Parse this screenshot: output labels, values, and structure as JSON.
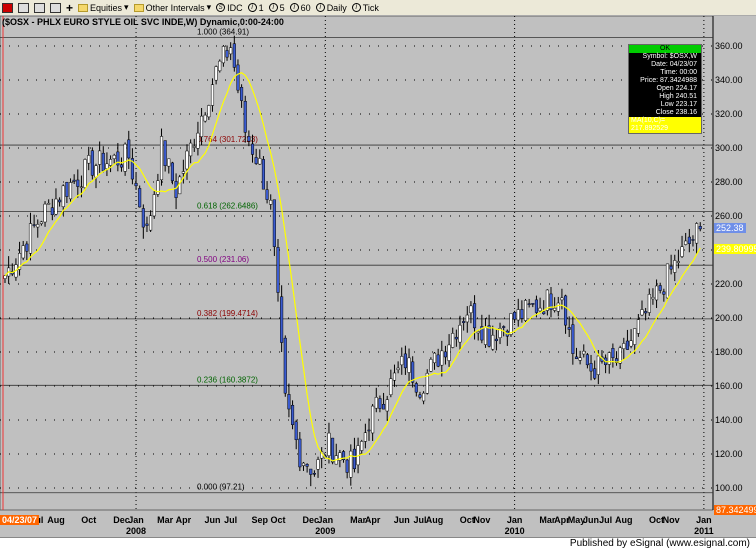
{
  "toolbar": {
    "items": [
      "Equities",
      "Other Intervals",
      "IDC",
      "1",
      "5",
      "60",
      "Daily",
      "Tick"
    ]
  },
  "title": "($OSX - PHLX EURO STYLE OIL SVC INDE,W) Dynamic,0:00-24:00",
  "info": {
    "status": "OK",
    "rows": [
      "Symbol: $OSX,W",
      "Date: 04/23/07",
      "Time: 00:00",
      "Price: 87.3424988",
      "Open 224.17",
      "High 240.51",
      "Low 223.17",
      "Close 238.16"
    ],
    "ma": "MA(10,C)= 217.892529"
  },
  "badges": {
    "last": "252.38",
    "ma": "239.80995",
    "cursor_price": "87.342499",
    "cursor_date": "04/23/07"
  },
  "footer": "Published by eSignal (www.esignal.com)",
  "colors": {
    "up": "#ffffff",
    "down": "#3a5bd0",
    "ma": "#ffff00",
    "grid": "#000000"
  },
  "chart_data": {
    "type": "candlestick",
    "ylim": [
      90,
      370
    ],
    "yticks": [
      "100.00",
      "120.00",
      "140.00",
      "160.00",
      "180.00",
      "200.00",
      "220.00",
      "240.00",
      "260.00",
      "280.00",
      "300.00",
      "320.00",
      "340.00",
      "360.00"
    ],
    "fib": [
      {
        "label": "1.000 (364.91)",
        "value": 364.91,
        "color": "#000000"
      },
      {
        "label": "0.764 (301.7223)",
        "value": 301.72,
        "color": "#8b0000"
      },
      {
        "label": "0.618 (262.6486)",
        "value": 262.65,
        "color": "#006400"
      },
      {
        "label": "0.500 (231.06)",
        "value": 231.06,
        "color": "#800080"
      },
      {
        "label": "0.382 (199.4714)",
        "value": 199.47,
        "color": "#8b0000"
      },
      {
        "label": "0.236 (160.3872)",
        "value": 160.39,
        "color": "#006400"
      },
      {
        "label": "0.000 (97.21)",
        "value": 97.21,
        "color": "#000000"
      }
    ],
    "keypoints_week_close": [
      [
        0,
        225
      ],
      [
        10,
        260
      ],
      [
        16,
        275
      ],
      [
        24,
        290
      ],
      [
        34,
        295
      ],
      [
        39,
        250
      ],
      [
        43,
        300
      ],
      [
        47,
        275
      ],
      [
        58,
        345
      ],
      [
        62,
        360
      ],
      [
        66,
        310
      ],
      [
        70,
        290
      ],
      [
        73,
        265
      ],
      [
        77,
        150
      ],
      [
        81,
        120
      ],
      [
        85,
        110
      ],
      [
        89,
        125
      ],
      [
        96,
        112
      ],
      [
        100,
        140
      ],
      [
        110,
        175
      ],
      [
        114,
        160
      ],
      [
        127,
        205
      ],
      [
        133,
        190
      ],
      [
        140,
        200
      ],
      [
        153,
        215
      ],
      [
        156,
        180
      ],
      [
        161,
        170
      ],
      [
        169,
        175
      ],
      [
        178,
        210
      ],
      [
        185,
        235
      ],
      [
        191,
        252.38
      ]
    ],
    "x_labels": [
      {
        "t": "nJul",
        "w": 8
      },
      {
        "t": "Aug",
        "w": 14
      },
      {
        "t": "Oct",
        "w": 23
      },
      {
        "t": "Dec",
        "w": 32
      },
      {
        "t": "Jan",
        "w": 36
      },
      {
        "t": "Mar",
        "w": 44
      },
      {
        "t": "Apr",
        "w": 49
      },
      {
        "t": "Jun",
        "w": 57
      },
      {
        "t": "Jul",
        "w": 62
      },
      {
        "t": "Sep",
        "w": 70
      },
      {
        "t": "Oct",
        "w": 75
      },
      {
        "t": "Dec",
        "w": 84
      },
      {
        "t": "Jan",
        "w": 88
      },
      {
        "t": "Mar",
        "w": 97
      },
      {
        "t": "Apr",
        "w": 101
      },
      {
        "t": "Jun",
        "w": 109
      },
      {
        "t": "Jul",
        "w": 114
      },
      {
        "t": "Aug",
        "w": 118
      },
      {
        "t": "Oct",
        "w": 127
      },
      {
        "t": "Nov",
        "w": 131
      },
      {
        "t": "Jan",
        "w": 140
      },
      {
        "t": "Mar",
        "w": 149
      },
      {
        "t": "Apr",
        "w": 153
      },
      {
        "t": "May",
        "w": 157
      },
      {
        "t": "Jun",
        "w": 161
      },
      {
        "t": "Jul",
        "w": 165
      },
      {
        "t": "Aug",
        "w": 170
      },
      {
        "t": "Oct",
        "w": 179
      },
      {
        "t": "Nov",
        "w": 183
      },
      {
        "t": "Jan",
        "w": 192
      }
    ],
    "years": [
      {
        "t": "2008",
        "w": 36
      },
      {
        "t": "2009",
        "w": 88
      },
      {
        "t": "2010",
        "w": 140
      },
      {
        "t": "2011",
        "w": 192
      }
    ]
  }
}
